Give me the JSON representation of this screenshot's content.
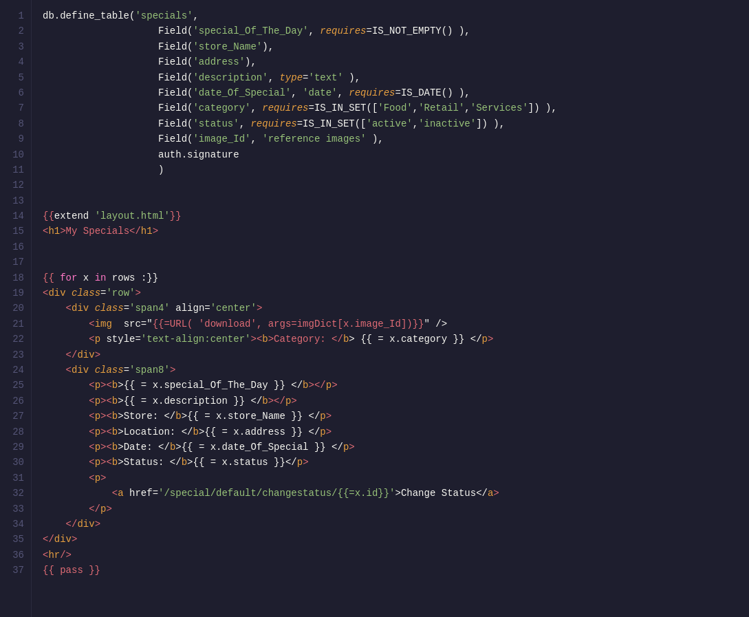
{
  "editor": {
    "background": "#1e1e2e",
    "lines": [
      {
        "num": 1,
        "tokens": [
          {
            "t": "db.define_table(",
            "c": "c-white"
          },
          {
            "t": "'specials'",
            "c": "c-green"
          },
          {
            "t": ",",
            "c": "c-white"
          }
        ]
      },
      {
        "num": 2,
        "tokens": [
          {
            "t": "                    Field(",
            "c": "c-white"
          },
          {
            "t": "'special_Of_The_Day'",
            "c": "c-green"
          },
          {
            "t": ", ",
            "c": "c-white"
          },
          {
            "t": "requires",
            "c": "c-attr"
          },
          {
            "t": "=IS_NOT_EMPTY() ),",
            "c": "c-white"
          }
        ]
      },
      {
        "num": 3,
        "tokens": [
          {
            "t": "                    Field(",
            "c": "c-white"
          },
          {
            "t": "'store_Name'",
            "c": "c-green"
          },
          {
            "t": "),",
            "c": "c-white"
          }
        ]
      },
      {
        "num": 4,
        "tokens": [
          {
            "t": "                    Field(",
            "c": "c-white"
          },
          {
            "t": "'address'",
            "c": "c-green"
          },
          {
            "t": "),",
            "c": "c-white"
          }
        ]
      },
      {
        "num": 5,
        "tokens": [
          {
            "t": "                    Field(",
            "c": "c-white"
          },
          {
            "t": "'description'",
            "c": "c-green"
          },
          {
            "t": ", ",
            "c": "c-white"
          },
          {
            "t": "type",
            "c": "c-attr"
          },
          {
            "t": "=",
            "c": "c-white"
          },
          {
            "t": "'text'",
            "c": "c-green"
          },
          {
            "t": " ),",
            "c": "c-white"
          }
        ]
      },
      {
        "num": 6,
        "tokens": [
          {
            "t": "                    Field(",
            "c": "c-white"
          },
          {
            "t": "'date_Of_Special'",
            "c": "c-green"
          },
          {
            "t": ", ",
            "c": "c-white"
          },
          {
            "t": "'date'",
            "c": "c-green"
          },
          {
            "t": ", ",
            "c": "c-white"
          },
          {
            "t": "requires",
            "c": "c-attr"
          },
          {
            "t": "=IS_DATE() ),",
            "c": "c-white"
          }
        ]
      },
      {
        "num": 7,
        "tokens": [
          {
            "t": "                    Field(",
            "c": "c-white"
          },
          {
            "t": "'category'",
            "c": "c-green"
          },
          {
            "t": ", ",
            "c": "c-white"
          },
          {
            "t": "requires",
            "c": "c-attr"
          },
          {
            "t": "=IS_IN_SET([",
            "c": "c-white"
          },
          {
            "t": "'Food'",
            "c": "c-green"
          },
          {
            "t": ",",
            "c": "c-white"
          },
          {
            "t": "'Retail'",
            "c": "c-green"
          },
          {
            "t": ",",
            "c": "c-white"
          },
          {
            "t": "'Services'",
            "c": "c-green"
          },
          {
            "t": "]) ),",
            "c": "c-white"
          }
        ]
      },
      {
        "num": 8,
        "tokens": [
          {
            "t": "                    Field(",
            "c": "c-white"
          },
          {
            "t": "'status'",
            "c": "c-green"
          },
          {
            "t": ", ",
            "c": "c-white"
          },
          {
            "t": "requires",
            "c": "c-attr"
          },
          {
            "t": "=IS_IN_SET([",
            "c": "c-white"
          },
          {
            "t": "'active'",
            "c": "c-green"
          },
          {
            "t": ",",
            "c": "c-white"
          },
          {
            "t": "'inactive'",
            "c": "c-green"
          },
          {
            "t": "]) ),",
            "c": "c-white"
          }
        ]
      },
      {
        "num": 9,
        "tokens": [
          {
            "t": "                    Field(",
            "c": "c-white"
          },
          {
            "t": "'image_Id'",
            "c": "c-green"
          },
          {
            "t": ", ",
            "c": "c-white"
          },
          {
            "t": "'reference images'",
            "c": "c-green"
          },
          {
            "t": " ),",
            "c": "c-white"
          }
        ]
      },
      {
        "num": 10,
        "tokens": [
          {
            "t": "                    auth.signature",
            "c": "c-white"
          }
        ]
      },
      {
        "num": 11,
        "tokens": [
          {
            "t": "                    )",
            "c": "c-white"
          }
        ]
      },
      {
        "num": 12,
        "tokens": []
      },
      {
        "num": 13,
        "tokens": []
      },
      {
        "num": 14,
        "tokens": [
          {
            "t": "{{",
            "c": "c-red"
          },
          {
            "t": "extend ",
            "c": "c-white"
          },
          {
            "t": "'layout.html'",
            "c": "c-green"
          },
          {
            "t": "}}",
            "c": "c-red"
          }
        ]
      },
      {
        "num": 15,
        "tokens": [
          {
            "t": "<",
            "c": "c-red"
          },
          {
            "t": "h1",
            "c": "c-orange"
          },
          {
            "t": ">My Specials</",
            "c": "c-red"
          },
          {
            "t": "h1",
            "c": "c-orange"
          },
          {
            "t": ">",
            "c": "c-red"
          }
        ]
      },
      {
        "num": 16,
        "tokens": []
      },
      {
        "num": 17,
        "tokens": []
      },
      {
        "num": 18,
        "tokens": [
          {
            "t": "{{ ",
            "c": "c-red"
          },
          {
            "t": "for",
            "c": "c-pink"
          },
          {
            "t": " x ",
            "c": "c-white"
          },
          {
            "t": "in",
            "c": "c-pink"
          },
          {
            "t": " rows :}}",
            "c": "c-white"
          }
        ]
      },
      {
        "num": 19,
        "tokens": [
          {
            "t": "<",
            "c": "c-red"
          },
          {
            "t": "div",
            "c": "c-orange"
          },
          {
            "t": " ",
            "c": "c-white"
          },
          {
            "t": "class",
            "c": "c-attr"
          },
          {
            "t": "=",
            "c": "c-white"
          },
          {
            "t": "'row'",
            "c": "c-green"
          },
          {
            "t": ">",
            "c": "c-red"
          }
        ]
      },
      {
        "num": 20,
        "tokens": [
          {
            "t": "    <",
            "c": "c-red"
          },
          {
            "t": "div",
            "c": "c-orange"
          },
          {
            "t": " ",
            "c": "c-white"
          },
          {
            "t": "class",
            "c": "c-attr"
          },
          {
            "t": "=",
            "c": "c-white"
          },
          {
            "t": "'span4'",
            "c": "c-green"
          },
          {
            "t": " align=",
            "c": "c-white"
          },
          {
            "t": "'center'",
            "c": "c-green"
          },
          {
            "t": ">",
            "c": "c-red"
          }
        ]
      },
      {
        "num": 21,
        "tokens": [
          {
            "t": "        <",
            "c": "c-red"
          },
          {
            "t": "img",
            "c": "c-orange"
          },
          {
            "t": "  src=\"",
            "c": "c-white"
          },
          {
            "t": "{{=URL( 'download', args=imgDict[x.image_Id])}}",
            "c": "c-red"
          },
          {
            "t": "\" />",
            "c": "c-white"
          }
        ]
      },
      {
        "num": 22,
        "tokens": [
          {
            "t": "        <",
            "c": "c-red"
          },
          {
            "t": "p",
            "c": "c-orange"
          },
          {
            "t": " style=",
            "c": "c-white"
          },
          {
            "t": "'text-align:center'",
            "c": "c-green"
          },
          {
            "t": "><",
            "c": "c-red"
          },
          {
            "t": "b",
            "c": "c-orange"
          },
          {
            "t": ">Category: </",
            "c": "c-red"
          },
          {
            "t": "b",
            "c": "c-orange"
          },
          {
            "t": "> {{ = x.category }} </",
            "c": "c-white"
          },
          {
            "t": "p",
            "c": "c-orange"
          },
          {
            "t": ">",
            "c": "c-red"
          }
        ]
      },
      {
        "num": 23,
        "tokens": [
          {
            "t": "    </",
            "c": "c-red"
          },
          {
            "t": "div",
            "c": "c-orange"
          },
          {
            "t": ">",
            "c": "c-red"
          }
        ]
      },
      {
        "num": 24,
        "tokens": [
          {
            "t": "    <",
            "c": "c-red"
          },
          {
            "t": "div",
            "c": "c-orange"
          },
          {
            "t": " ",
            "c": "c-white"
          },
          {
            "t": "class",
            "c": "c-attr"
          },
          {
            "t": "=",
            "c": "c-white"
          },
          {
            "t": "'span8'",
            "c": "c-green"
          },
          {
            "t": ">",
            "c": "c-red"
          }
        ]
      },
      {
        "num": 25,
        "tokens": [
          {
            "t": "        <",
            "c": "c-red"
          },
          {
            "t": "p",
            "c": "c-orange"
          },
          {
            "t": "><",
            "c": "c-red"
          },
          {
            "t": "b",
            "c": "c-orange"
          },
          {
            "t": ">{{ = x.special_Of_The_Day }} </",
            "c": "c-white"
          },
          {
            "t": "b",
            "c": "c-orange"
          },
          {
            "t": "></",
            "c": "c-red"
          },
          {
            "t": "p",
            "c": "c-orange"
          },
          {
            "t": ">",
            "c": "c-red"
          }
        ]
      },
      {
        "num": 26,
        "tokens": [
          {
            "t": "        <",
            "c": "c-red"
          },
          {
            "t": "p",
            "c": "c-orange"
          },
          {
            "t": "><",
            "c": "c-red"
          },
          {
            "t": "b",
            "c": "c-orange"
          },
          {
            "t": ">{{ = x.description }} </",
            "c": "c-white"
          },
          {
            "t": "b",
            "c": "c-orange"
          },
          {
            "t": "></",
            "c": "c-red"
          },
          {
            "t": "p",
            "c": "c-orange"
          },
          {
            "t": ">",
            "c": "c-red"
          }
        ]
      },
      {
        "num": 27,
        "tokens": [
          {
            "t": "        <",
            "c": "c-red"
          },
          {
            "t": "p",
            "c": "c-orange"
          },
          {
            "t": "><",
            "c": "c-red"
          },
          {
            "t": "b",
            "c": "c-orange"
          },
          {
            "t": ">Store: </",
            "c": "c-white"
          },
          {
            "t": "b",
            "c": "c-orange"
          },
          {
            "t": ">{{ = x.store_Name }} </",
            "c": "c-white"
          },
          {
            "t": "p",
            "c": "c-orange"
          },
          {
            "t": ">",
            "c": "c-red"
          }
        ]
      },
      {
        "num": 28,
        "tokens": [
          {
            "t": "        <",
            "c": "c-red"
          },
          {
            "t": "p",
            "c": "c-orange"
          },
          {
            "t": "><",
            "c": "c-red"
          },
          {
            "t": "b",
            "c": "c-orange"
          },
          {
            "t": ">Location: </",
            "c": "c-white"
          },
          {
            "t": "b",
            "c": "c-orange"
          },
          {
            "t": ">{{ = x.address }} </",
            "c": "c-white"
          },
          {
            "t": "p",
            "c": "c-orange"
          },
          {
            "t": ">",
            "c": "c-red"
          }
        ]
      },
      {
        "num": 29,
        "tokens": [
          {
            "t": "        <",
            "c": "c-red"
          },
          {
            "t": "p",
            "c": "c-orange"
          },
          {
            "t": "><",
            "c": "c-red"
          },
          {
            "t": "b",
            "c": "c-orange"
          },
          {
            "t": ">Date: </",
            "c": "c-white"
          },
          {
            "t": "b",
            "c": "c-orange"
          },
          {
            "t": ">{{ = x.date_Of_Special }} </",
            "c": "c-white"
          },
          {
            "t": "p",
            "c": "c-orange"
          },
          {
            "t": ">",
            "c": "c-red"
          }
        ]
      },
      {
        "num": 30,
        "tokens": [
          {
            "t": "        <",
            "c": "c-red"
          },
          {
            "t": "p",
            "c": "c-orange"
          },
          {
            "t": "><",
            "c": "c-red"
          },
          {
            "t": "b",
            "c": "c-orange"
          },
          {
            "t": ">Status: </",
            "c": "c-white"
          },
          {
            "t": "b",
            "c": "c-orange"
          },
          {
            "t": ">{{ = x.status }}</",
            "c": "c-white"
          },
          {
            "t": "p",
            "c": "c-orange"
          },
          {
            "t": ">",
            "c": "c-red"
          }
        ]
      },
      {
        "num": 31,
        "tokens": [
          {
            "t": "        <",
            "c": "c-red"
          },
          {
            "t": "p",
            "c": "c-orange"
          },
          {
            "t": ">",
            "c": "c-red"
          }
        ]
      },
      {
        "num": 32,
        "tokens": [
          {
            "t": "            <",
            "c": "c-red"
          },
          {
            "t": "a",
            "c": "c-orange"
          },
          {
            "t": " href=",
            "c": "c-white"
          },
          {
            "t": "'/special/default/changestatus/{{=x.id}}'",
            "c": "c-green"
          },
          {
            "t": ">Change Status</",
            "c": "c-white"
          },
          {
            "t": "a",
            "c": "c-orange"
          },
          {
            "t": ">",
            "c": "c-red"
          }
        ]
      },
      {
        "num": 33,
        "tokens": [
          {
            "t": "        </",
            "c": "c-red"
          },
          {
            "t": "p",
            "c": "c-orange"
          },
          {
            "t": ">",
            "c": "c-red"
          }
        ]
      },
      {
        "num": 34,
        "tokens": [
          {
            "t": "    </",
            "c": "c-red"
          },
          {
            "t": "div",
            "c": "c-orange"
          },
          {
            "t": ">",
            "c": "c-red"
          }
        ]
      },
      {
        "num": 35,
        "tokens": [
          {
            "t": "</",
            "c": "c-red"
          },
          {
            "t": "div",
            "c": "c-orange"
          },
          {
            "t": ">",
            "c": "c-red"
          }
        ]
      },
      {
        "num": 36,
        "tokens": [
          {
            "t": "<",
            "c": "c-red"
          },
          {
            "t": "hr",
            "c": "c-orange"
          },
          {
            "t": "/>",
            "c": "c-red"
          }
        ]
      },
      {
        "num": 37,
        "tokens": [
          {
            "t": "{{ pass }}",
            "c": "c-red"
          }
        ]
      }
    ]
  }
}
